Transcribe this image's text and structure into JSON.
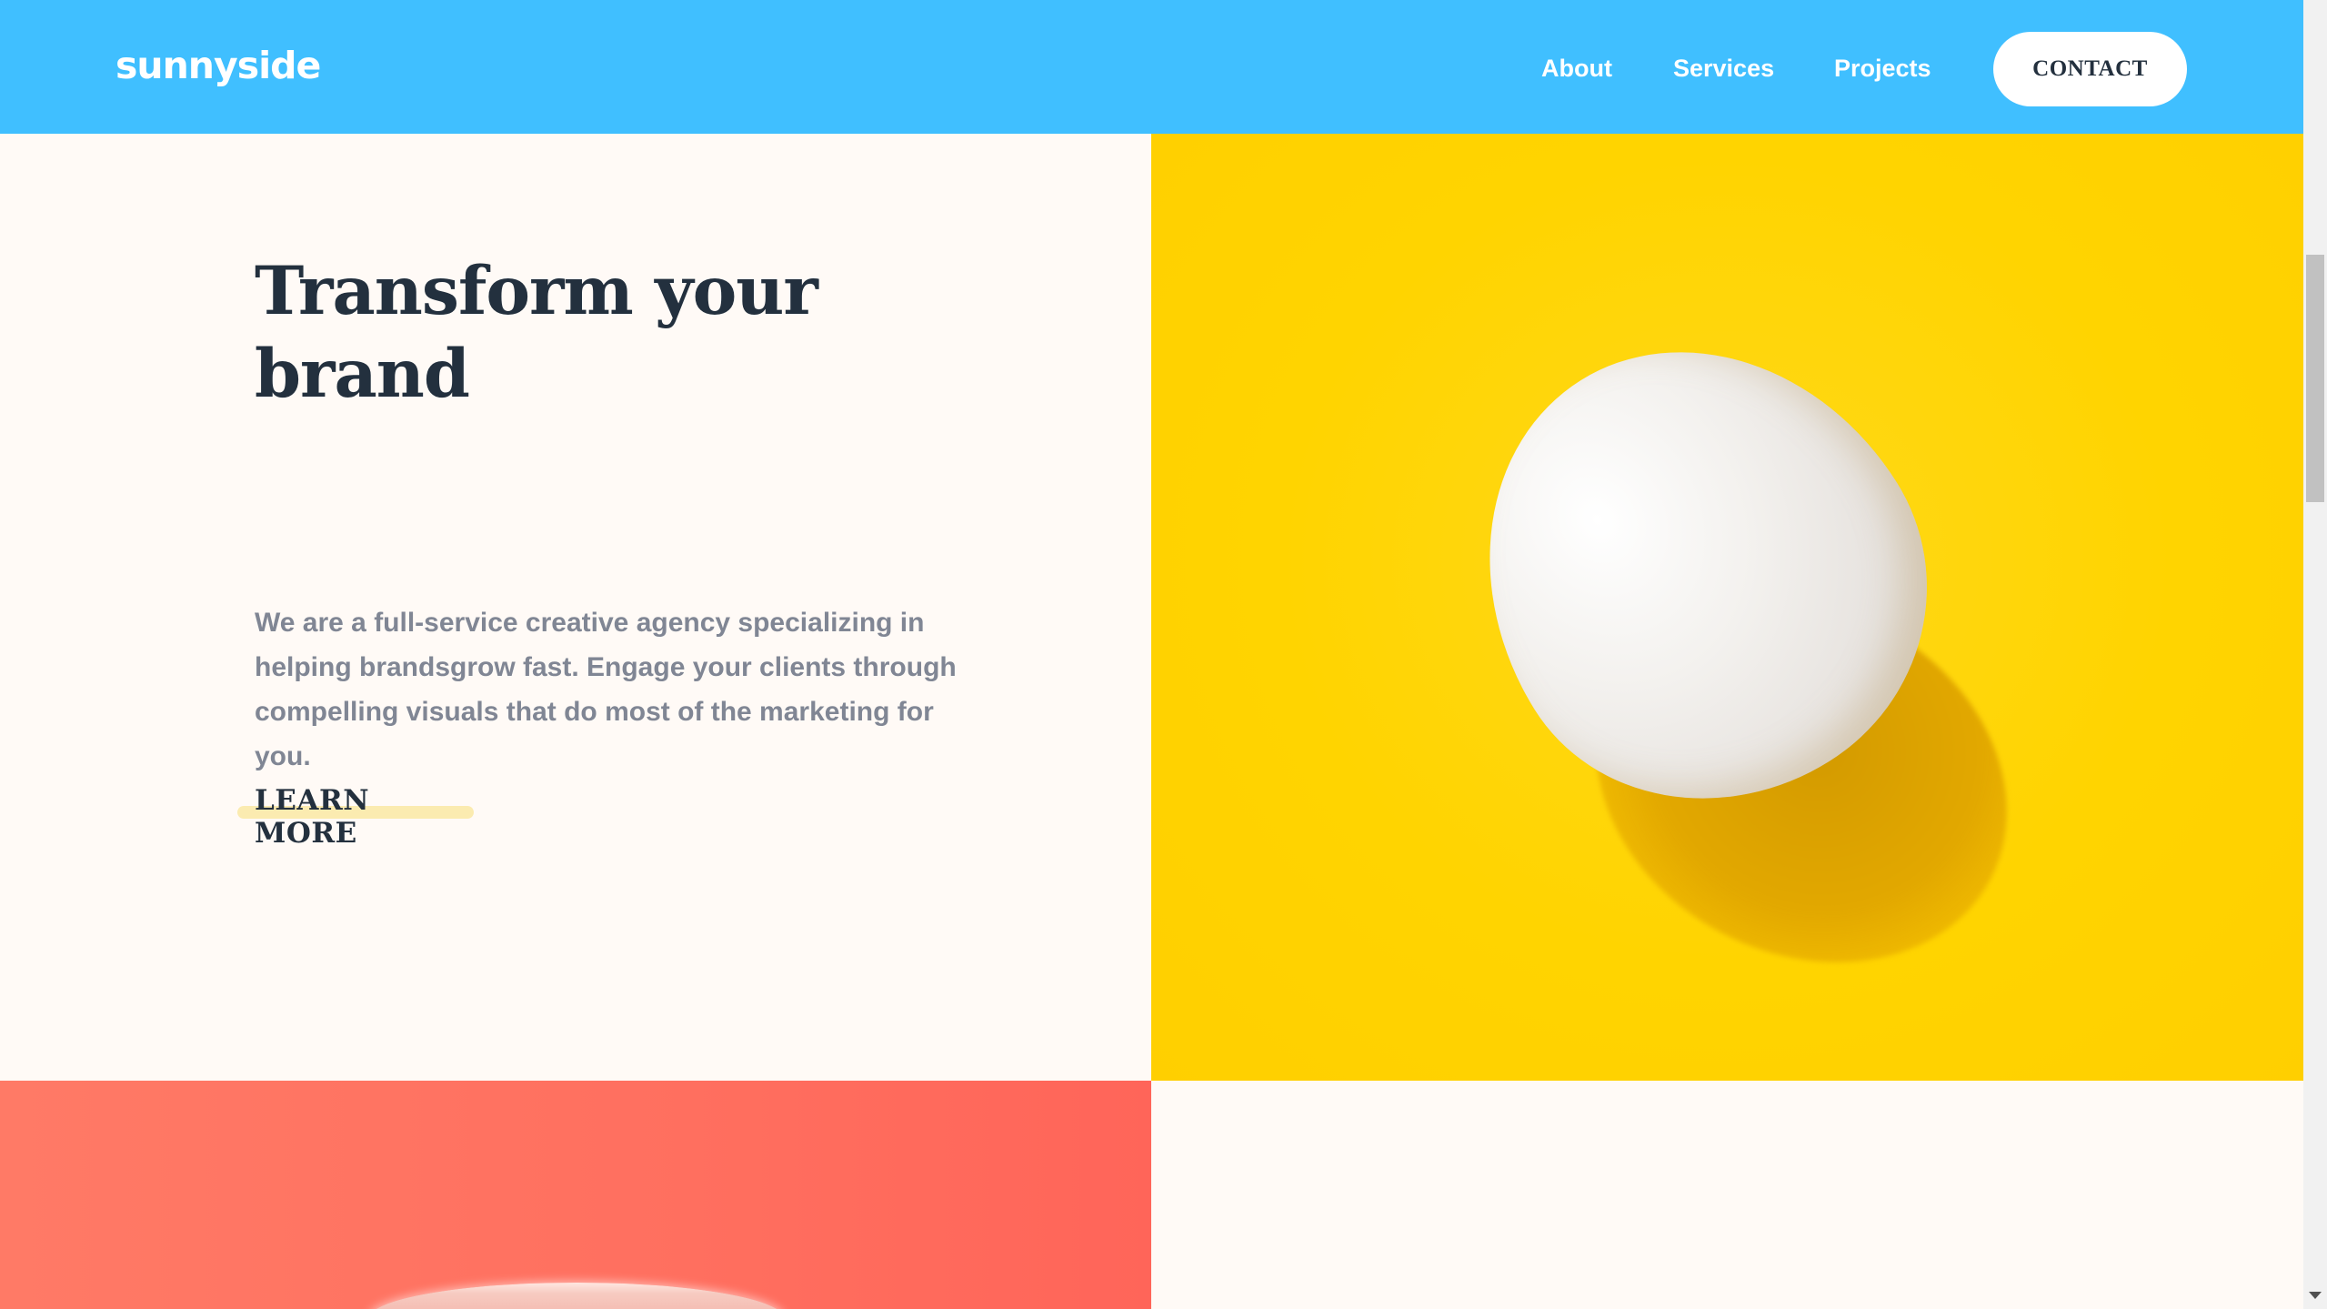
{
  "header": {
    "logo": "sunnyside",
    "nav": {
      "about": "About",
      "services": "Services",
      "projects": "Projects",
      "contact": "CONTACT"
    },
    "background_color": "#40bfff"
  },
  "hero": {
    "title_line1": "Transform your",
    "title_line2": "brand",
    "paragraph": "We are a full-service creative agency specializing in helping brandsgrow fast. Engage your clients through compelling visuals that do most of the marketing for you.",
    "link_label": "LEARN MORE",
    "image_icon": "egg-image",
    "image_background": "#ffd400"
  },
  "second_row": {
    "image_icon": "cup-image",
    "image_background": "#ff6f5f"
  },
  "colors": {
    "page_background": "#fffaf6",
    "heading": "#23303e",
    "body_text": "#808694",
    "underline_accent": "#fbebb0"
  }
}
